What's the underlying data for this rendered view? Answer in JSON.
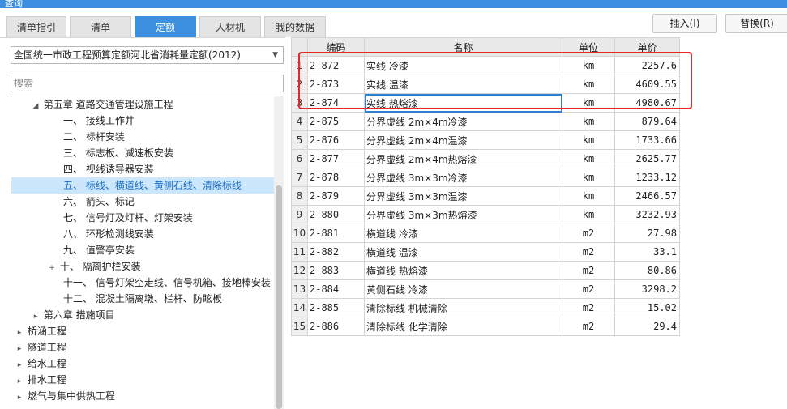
{
  "window": {
    "title": "查询"
  },
  "tabs": [
    {
      "label": "清单指引"
    },
    {
      "label": "清单"
    },
    {
      "label": "定额"
    },
    {
      "label": "人材机"
    },
    {
      "label": "我的数据"
    }
  ],
  "buttons": {
    "insert": "插入(I)",
    "replace": "替换(R)"
  },
  "library_select": {
    "value": "全国统一市政工程预算定额河北省消耗量定额(2012)"
  },
  "search": {
    "placeholder": "搜索"
  },
  "tree": [
    {
      "label": "第五章 道路交通管理设施工程",
      "toggle": "◢"
    },
    {
      "label": "一、 接线工作井"
    },
    {
      "label": "二、 标杆安装"
    },
    {
      "label": "三、 标志板、减速板安装"
    },
    {
      "label": "四、 视线诱导器安装"
    },
    {
      "label": "五、 标线、横道线、黄侧石线、清除标线"
    },
    {
      "label": "六、 箭头、标记"
    },
    {
      "label": "七、 信号灯及灯杆、灯架安装"
    },
    {
      "label": "八、 环形检测线安装"
    },
    {
      "label": "九、 值警亭安装"
    },
    {
      "label": "十、 隔离护栏安装",
      "toggle": "+"
    },
    {
      "label": "十一、 信号灯架空走线、信号机箱、接地棒安装"
    },
    {
      "label": "十二、 混凝土隔离墩、栏杆、防眩板"
    },
    {
      "label": "第六章 措施项目",
      "toggle": "▸"
    },
    {
      "label": "桥涵工程",
      "toggle": "▸"
    },
    {
      "label": "隧道工程",
      "toggle": "▸"
    },
    {
      "label": "给水工程",
      "toggle": "▸"
    },
    {
      "label": "排水工程",
      "toggle": "▸"
    },
    {
      "label": "燃气与集中供热工程",
      "toggle": "▸"
    }
  ],
  "grid": {
    "headers": {
      "code": "编码",
      "name": "名称",
      "unit": "单位",
      "price": "单价"
    },
    "rows": [
      {
        "idx": "1",
        "code": "2-872",
        "name": "实线 冷漆",
        "unit": "km",
        "price": "2257.6"
      },
      {
        "idx": "2",
        "code": "2-873",
        "name": "实线 温漆",
        "unit": "km",
        "price": "4609.55"
      },
      {
        "idx": "3",
        "code": "2-874",
        "name": "实线 热熔漆",
        "unit": "km",
        "price": "4980.67"
      },
      {
        "idx": "4",
        "code": "2-875",
        "name": "分界虚线 2m×4m冷漆",
        "unit": "km",
        "price": "879.64"
      },
      {
        "idx": "5",
        "code": "2-876",
        "name": "分界虚线 2m×4m温漆",
        "unit": "km",
        "price": "1733.66"
      },
      {
        "idx": "6",
        "code": "2-877",
        "name": "分界虚线 2m×4m热熔漆",
        "unit": "km",
        "price": "2625.77"
      },
      {
        "idx": "7",
        "code": "2-878",
        "name": "分界虚线 3m×3m冷漆",
        "unit": "km",
        "price": "1233.12"
      },
      {
        "idx": "8",
        "code": "2-879",
        "name": "分界虚线 3m×3m温漆",
        "unit": "km",
        "price": "2466.57"
      },
      {
        "idx": "9",
        "code": "2-880",
        "name": "分界虚线 3m×3m热熔漆",
        "unit": "km",
        "price": "3232.93"
      },
      {
        "idx": "10",
        "code": "2-881",
        "name": "横道线 冷漆",
        "unit": "m2",
        "price": "27.98"
      },
      {
        "idx": "11",
        "code": "2-882",
        "name": "横道线 温漆",
        "unit": "m2",
        "price": "33.1"
      },
      {
        "idx": "12",
        "code": "2-883",
        "name": "横道线 热熔漆",
        "unit": "m2",
        "price": "80.86"
      },
      {
        "idx": "13",
        "code": "2-884",
        "name": "黄侧石线 冷漆",
        "unit": "m2",
        "price": "3298.2"
      },
      {
        "idx": "14",
        "code": "2-885",
        "name": "清除标线 机械清除",
        "unit": "m2",
        "price": "15.02"
      },
      {
        "idx": "15",
        "code": "2-886",
        "name": "清除标线 化学清除",
        "unit": "m2",
        "price": "29.4"
      }
    ]
  },
  "colors": {
    "accent": "#3d8fe0",
    "highlight_box": "#e8242b",
    "selected_tree": "#cce6fb"
  }
}
